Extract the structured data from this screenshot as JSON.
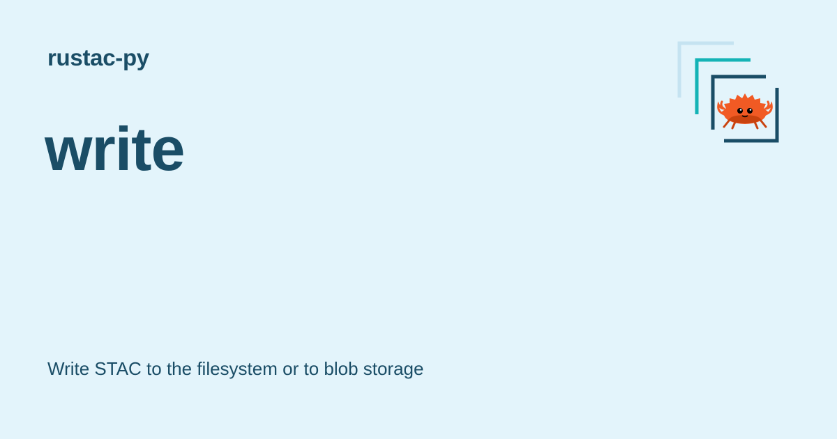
{
  "site": {
    "name": "rustac-py"
  },
  "page": {
    "title": "write",
    "description": "Write STAC to the filesystem or to blob storage"
  },
  "logo": {
    "icon": "rustac-crab-logo-icon",
    "colors": {
      "frame_back": "#c5e3f1",
      "frame_middle": "#14b3b6",
      "frame_front": "#1a4d66",
      "crab_body": "#f15a24",
      "crab_shade": "#c9430f"
    }
  },
  "theme": {
    "background": "#e3f4fb",
    "text": "#1a4d66"
  }
}
